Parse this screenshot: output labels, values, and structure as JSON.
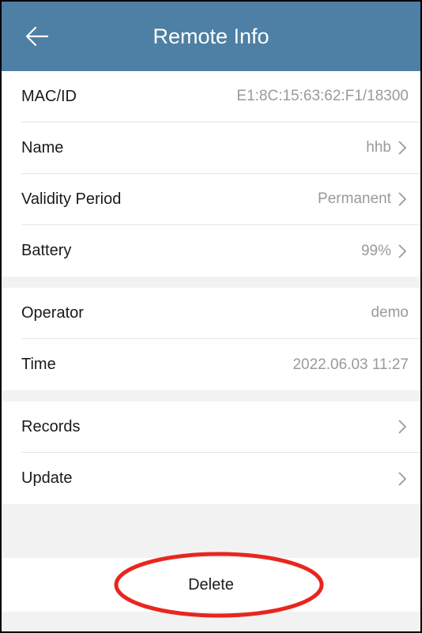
{
  "header": {
    "title": "Remote Info"
  },
  "info_group": [
    {
      "label": "MAC/ID",
      "value": "E1:8C:15:63:62:F1/18300",
      "chevron": false
    },
    {
      "label": "Name",
      "value": "hhb",
      "chevron": true
    },
    {
      "label": "Validity Period",
      "value": "Permanent",
      "chevron": true
    },
    {
      "label": "Battery",
      "value": "99%",
      "chevron": true
    }
  ],
  "operator_group": [
    {
      "label": "Operator",
      "value": "demo"
    },
    {
      "label": "Time",
      "value": "2022.06.03 11:27"
    }
  ],
  "actions_group": [
    {
      "label": "Records"
    },
    {
      "label": "Update"
    }
  ],
  "delete_label": "Delete",
  "colors": {
    "header_bg": "#4e7fa4",
    "highlight_oval": "#e8261f"
  },
  "icons": {
    "back": "back-arrow-icon",
    "chevron": "chevron-right-icon"
  }
}
